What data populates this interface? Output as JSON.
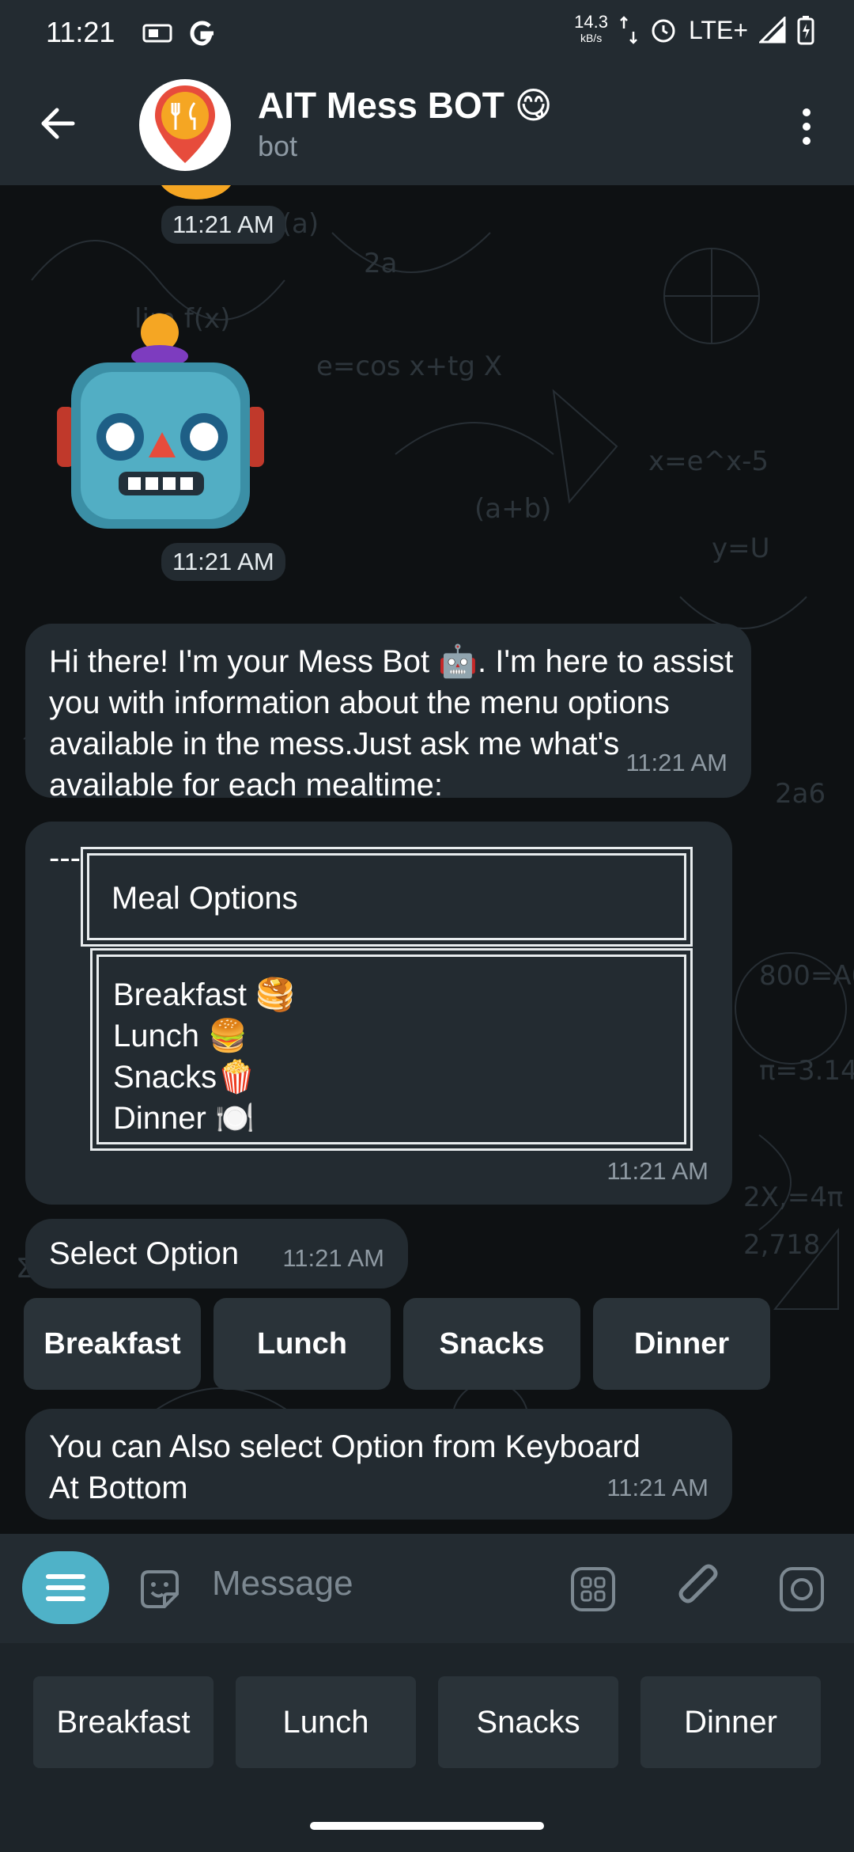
{
  "status_bar": {
    "time": "11:21",
    "net_speed": "14.3",
    "net_unit": "kB/s",
    "network": "LTE+"
  },
  "header": {
    "title": "AIT Mess BOT 😋",
    "subtitle": "bot"
  },
  "messages": {
    "sticker1_time": "11:21 AM",
    "sticker2_time": "11:21 AM",
    "intro_text": "Hi there! I'm your Mess Bot 🤖. I'm here to assist you with information about the menu options available in the mess.Just ask me what's available for each mealtime:",
    "intro_time": "11:21 AM",
    "menu_prefix": "---",
    "menu_title": "Meal Options",
    "menu_items": [
      "Breakfast 🥞",
      "Lunch 🍔",
      "Snacks🍿",
      "Dinner 🍽️"
    ],
    "menu_time": "11:21 AM",
    "select_text": "Select Option",
    "select_time": "11:21 AM",
    "inline_buttons": [
      "Breakfast",
      "Lunch",
      "Snacks",
      "Dinner"
    ],
    "keyboard_hint_line1": "You can Also select Option from Keyboard",
    "keyboard_hint_line2": "At Bottom",
    "keyboard_hint_time": "11:21 AM"
  },
  "composer": {
    "placeholder": "Message"
  },
  "reply_keyboard": [
    "Breakfast",
    "Lunch",
    "Snacks",
    "Dinner"
  ],
  "colors": {
    "accent": "#4fb2c8",
    "bubble": "#232b31",
    "header": "#232b31"
  }
}
